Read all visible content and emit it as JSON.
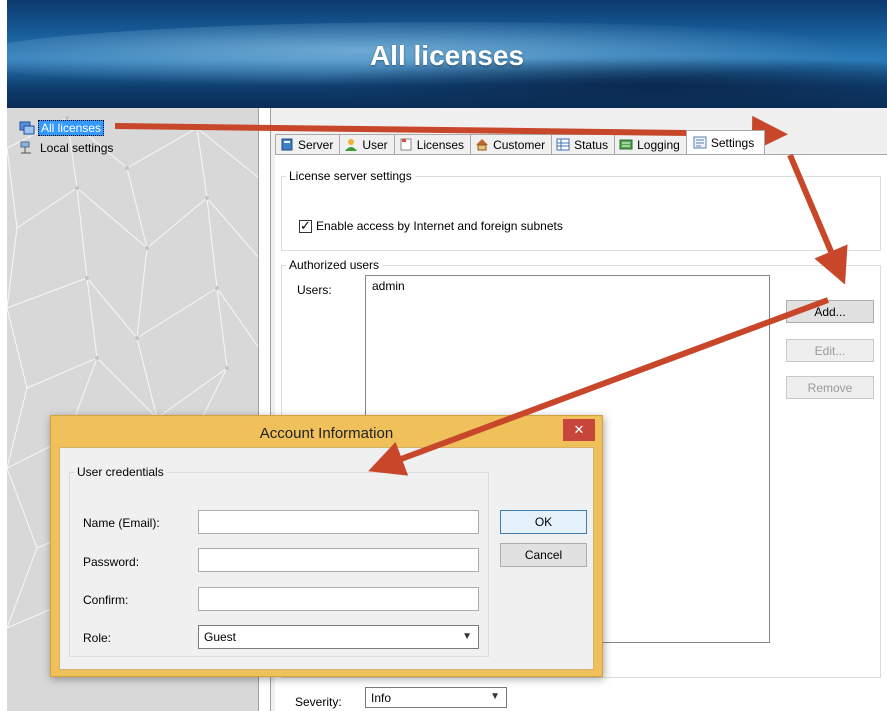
{
  "banner": {
    "title": "All licenses"
  },
  "tree": {
    "items": [
      {
        "label": "All licenses",
        "icon": "licenses-tree-icon",
        "selected": true
      },
      {
        "label": "Local settings",
        "icon": "network-settings-icon",
        "selected": false
      }
    ]
  },
  "tabs": [
    {
      "label": "Server",
      "icon": "server-icon"
    },
    {
      "label": "User",
      "icon": "user-icon"
    },
    {
      "label": "Licenses",
      "icon": "license-icon"
    },
    {
      "label": "Customer",
      "icon": "home-icon"
    },
    {
      "label": "Status",
      "icon": "status-icon"
    },
    {
      "label": "Logging",
      "icon": "logging-icon"
    },
    {
      "label": "Settings",
      "icon": "settings-icon",
      "active": true
    }
  ],
  "settings": {
    "server_group_label": "License server settings",
    "enable_access_label": "Enable access by Internet and foreign subnets",
    "enable_access_checked": true,
    "authorized_group_label": "Authorized users",
    "users_label": "Users:",
    "users": [
      "admin"
    ],
    "add_button": "Add...",
    "edit_button": "Edit...",
    "remove_button": "Remove",
    "severity_label": "Severity:",
    "severity_value": "Info"
  },
  "dialog": {
    "title": "Account Information",
    "close_glyph": "✕",
    "group_label": "User credentials",
    "name_label": "Name (Email):",
    "name_value": "",
    "password_label": "Password:",
    "password_value": "",
    "confirm_label": "Confirm:",
    "confirm_value": "",
    "role_label": "Role:",
    "role_value": "Guest",
    "ok_button": "OK",
    "cancel_button": "Cancel"
  },
  "colors": {
    "annotation_arrow": "#c8472a",
    "dialog_frame": "#f0c05a",
    "selection": "#3399ff",
    "close_button": "#c7463c"
  }
}
